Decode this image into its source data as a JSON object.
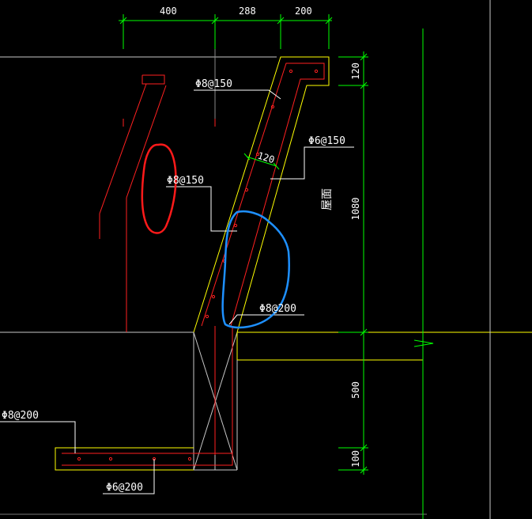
{
  "colors": {
    "background": "#000000",
    "dimension": "#00ff00",
    "outline": "#ffff00",
    "rebar": "#ff2020",
    "leader": "#ffffff",
    "guide": "#c0c0c0",
    "markup_red": "#ff1a1a",
    "markup_blue": "#1e90ff"
  },
  "dimensions": {
    "top": [
      "400",
      "288",
      "200"
    ],
    "thickness": "120",
    "right": [
      "120",
      "1080",
      "500",
      "100"
    ]
  },
  "annotations": {
    "rebar_top": "Φ8@150",
    "rebar_mid": "Φ6@150",
    "rebar_left": "Φ8@150",
    "rebar_lower": "Φ8@200",
    "rebar_footing": "Φ8@200",
    "rebar_bottom": "Φ6@200",
    "roof_label": "屋面"
  }
}
